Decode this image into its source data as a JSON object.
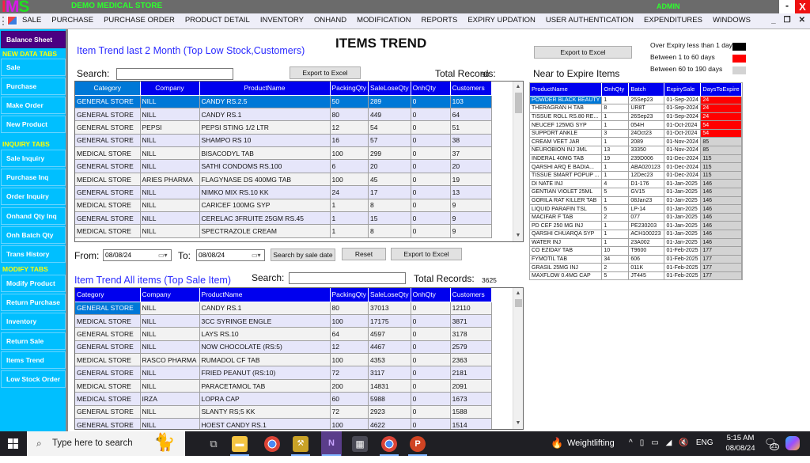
{
  "titlebar": {
    "logo": [
      "I",
      "M",
      "S"
    ],
    "app_title": "DEMO MEDICAL STORE",
    "user": "ADMIN",
    "minimize": "-",
    "close": "X"
  },
  "menubar": {
    "items": [
      "SALE",
      "PURCHASE",
      "PURCHASE ORDER",
      "PRODUCT DETAIL",
      "INVENTORY",
      "ONHAND",
      "MODIFICATION",
      "REPORTS",
      "EXPIRY UPDATION",
      "USER AUTHENTICATION",
      "EXPENDITURES",
      "WINDOWS"
    ],
    "mdi_min": "_",
    "mdi_restore": "❐",
    "mdi_close": "✕"
  },
  "sidebar": {
    "balance_sheet": "Balance Sheet",
    "headers": {
      "new_data": "NEW DATA TABS",
      "inquiry": "INQUIRY TABS",
      "modify": "MODIFY TABS"
    },
    "new_data_items": [
      "Sale",
      "Purchase",
      "Make Order",
      "New Product"
    ],
    "inquiry_items": [
      "Sale Inquiry",
      "Purchase Inq",
      "Order Inquiry",
      "Onhand Qty Inq",
      "Onh Batch Qty",
      "Trans History"
    ],
    "modify_items": [
      "Modify Product",
      "Return Purchase",
      "Inventory",
      "Return Sale",
      "Items Trend",
      "Low Stock Order"
    ]
  },
  "main": {
    "page_title": "ITEMS TREND",
    "top_section": {
      "title": "Item Trend last 2 Month (Top Low Stock,Customers)",
      "search_label": "Search:",
      "search_value": "",
      "export_label": "Export to Excel",
      "total_label": "Total Records:",
      "total_value": "90",
      "columns": [
        "Category",
        "Company",
        "ProductName",
        "PackingQty",
        "SaleLoseQty",
        "OnhQty",
        "Customers"
      ],
      "rows": [
        [
          "GENERAL STORE",
          "NILL",
          "CANDY RS.2.5",
          "50",
          "289",
          "0",
          "103"
        ],
        [
          "GENERAL STORE",
          "NILL",
          "CANDY RS.1",
          "80",
          "449",
          "0",
          "64"
        ],
        [
          "GENERAL STORE",
          "PEPSI",
          "PEPSI STING 1/2 LTR",
          "12",
          "54",
          "0",
          "51"
        ],
        [
          "GENERAL STORE",
          "NILL",
          "SHAMPO RS 10",
          "16",
          "57",
          "0",
          "38"
        ],
        [
          "MEDICAL STORE",
          "NILL",
          "BISACODYL TAB",
          "100",
          "299",
          "0",
          "37"
        ],
        [
          "GENERAL STORE",
          "NILL",
          "SATHI CONDOMS RS.100",
          "6",
          "20",
          "0",
          "20"
        ],
        [
          "MEDICAL STORE",
          "ARIES PHARMA",
          "FLAGYNASE DS 400MG TAB",
          "100",
          "45",
          "0",
          "19"
        ],
        [
          "GENERAL STORE",
          "NILL",
          "NIMKO MIX RS.10 KK",
          "24",
          "17",
          "0",
          "13"
        ],
        [
          "MEDICAL STORE",
          "NILL",
          "CARICEF 100MG SYP",
          "1",
          "8",
          "0",
          "9"
        ],
        [
          "GENERAL STORE",
          "NILL",
          "CERELAC 3FRUITE 25GM RS.45",
          "1",
          "15",
          "0",
          "9"
        ],
        [
          "MEDICAL STORE",
          "NILL",
          "SPECTRAZOLE CREAM",
          "1",
          "8",
          "0",
          "9"
        ]
      ]
    },
    "date_filter": {
      "from_label": "From:",
      "from_value": "08/08/24",
      "to_label": "To:",
      "to_value": "08/08/24",
      "search_by_date": "Search by sale date",
      "reset": "Reset",
      "export": "Export to Excel"
    },
    "bottom_section": {
      "title": "Item Trend All items (Top Sale Item)",
      "search_label": "Search:",
      "search_value": "",
      "total_label": "Total Records:",
      "total_value": "3625",
      "columns": [
        "Category",
        "Company",
        "ProductName",
        "PackingQty",
        "SaleLoseQty",
        "OnhQty",
        "Customers"
      ],
      "rows": [
        [
          "GENERAL STORE",
          "NILL",
          "CANDY RS.1",
          "80",
          "37013",
          "0",
          "12110"
        ],
        [
          "MEDICAL STORE",
          "NILL",
          "3CC SYRINGE ENGLE",
          "100",
          "17175",
          "0",
          "3871"
        ],
        [
          "GENERAL STORE",
          "NILL",
          "LAYS RS.10",
          "64",
          "4597",
          "0",
          "3178"
        ],
        [
          "GENERAL STORE",
          "NILL",
          "NOW CHOCOLATE (RS:5)",
          "12",
          "4467",
          "0",
          "2579"
        ],
        [
          "MEDICAL STORE",
          "RASCO PHARMA",
          "RUMADOL CF TAB",
          "100",
          "4353",
          "0",
          "2363"
        ],
        [
          "GENERAL STORE",
          "NILL",
          "FRIED PEANUT (RS:10)",
          "72",
          "3117",
          "0",
          "2181"
        ],
        [
          "MEDICAL STORE",
          "NILL",
          "PARACETAMOL TAB",
          "200",
          "14831",
          "0",
          "2091"
        ],
        [
          "MEDICAL STORE",
          "IRZA",
          "LOPRA CAP",
          "60",
          "5988",
          "0",
          "1673"
        ],
        [
          "GENERAL STORE",
          "NILL",
          "SLANTY RS;5 KK",
          "72",
          "2923",
          "0",
          "1588"
        ],
        [
          "GENERAL STORE",
          "NILL",
          "HOEST CANDY RS.1",
          "100",
          "4622",
          "0",
          "1514"
        ]
      ]
    },
    "expiry": {
      "export_label": "Export to Excel",
      "title": "Near to Expire Items",
      "legend": [
        {
          "label": "Over Expiry less than 1 day",
          "color": "#000000"
        },
        {
          "label": "Between 1 to 60 days",
          "color": "#ff0000"
        },
        {
          "label": "Between 60 to 190 days",
          "color": "#d3d3d3"
        }
      ],
      "columns": [
        "ProductName",
        "OnhQty",
        "Batch",
        "ExpirySale",
        "DaysToExpire"
      ],
      "rows": [
        [
          "POWDER BLACK BEAUTY",
          "1",
          "25Sep23",
          "01-Sep-2024",
          "24"
        ],
        [
          "THERAGRAN H TAB",
          "8",
          "UR8T",
          "01-Sep-2024",
          "24"
        ],
        [
          "TISSUE ROLL RS.80 RE...",
          "1",
          "26Sep23",
          "01-Sep-2024",
          "24"
        ],
        [
          "NEUCEF 125MG SYP",
          "1",
          "054H",
          "01-Oct-2024",
          "54"
        ],
        [
          "SUPPORT ANKLE",
          "3",
          "24Oct23",
          "01-Oct-2024",
          "54"
        ],
        [
          "CREAM VEET JAR",
          "1",
          "2089",
          "01-Nov-2024",
          "85"
        ],
        [
          "NEUROBION INJ 3ML",
          "13",
          "33350",
          "01-Nov-2024",
          "85"
        ],
        [
          "INDERAL 40MG TAB",
          "19",
          "239D006",
          "01-Dec-2024",
          "115"
        ],
        [
          "QARSHI ARQ E BADIA...",
          "1",
          "ABA020123",
          "01-Dec-2024",
          "115"
        ],
        [
          "TISSUE SMART POPUP ...",
          "1",
          "12Dec23",
          "01-Dec-2024",
          "115"
        ],
        [
          "DI NATE INJ",
          "4",
          "D1-176",
          "01-Jan-2025",
          "146"
        ],
        [
          "GENTIAN VIOLET 25ML",
          "5",
          "GV15",
          "01-Jan-2025",
          "146"
        ],
        [
          "GORILA RAT KILLER TAB",
          "1",
          "08Jan23",
          "01-Jan-2025",
          "146"
        ],
        [
          "LIQUID PARAFIN TSL",
          "5",
          "LP-14",
          "01-Jan-2025",
          "146"
        ],
        [
          "MACIFAR F TAB",
          "2",
          "077",
          "01-Jan-2025",
          "146"
        ],
        [
          "PD CEF 250 MG INJ",
          "1",
          "PE230203",
          "01-Jan-2025",
          "146"
        ],
        [
          "QARSHI CHUARQA SYP",
          "1",
          "ACH100223",
          "01-Jan-2025",
          "146"
        ],
        [
          "WATER INJ",
          "1",
          "23A002",
          "01-Jan-2025",
          "146"
        ],
        [
          "CO EZIDAY TAB",
          "10",
          "T9600",
          "01-Feb-2025",
          "177"
        ],
        [
          "FYMOTIL TAB",
          "34",
          "606",
          "01-Feb-2025",
          "177"
        ],
        [
          "GRASIL 25MG INJ",
          "2",
          "011K",
          "01-Feb-2025",
          "177"
        ],
        [
          "MAXFLOW 0.4MG CAP",
          "5",
          "JT445",
          "01-Feb-2025",
          "177"
        ]
      ]
    }
  },
  "taskbar": {
    "search_placeholder": "Type here to search",
    "weather": "Weightlifting",
    "language": "ENG",
    "time": "5:15 AM",
    "date": "08/08/24",
    "notifications": "21"
  },
  "colors": {
    "grid_header": "#0000ee",
    "selection": "#0078d7",
    "sidebar": "#00bfff",
    "sidebar_header_text": "#ffff00",
    "balance_sheet": "#4b0082",
    "expiry_red": "#ff0000",
    "expiry_gray": "#d3d3d3"
  }
}
